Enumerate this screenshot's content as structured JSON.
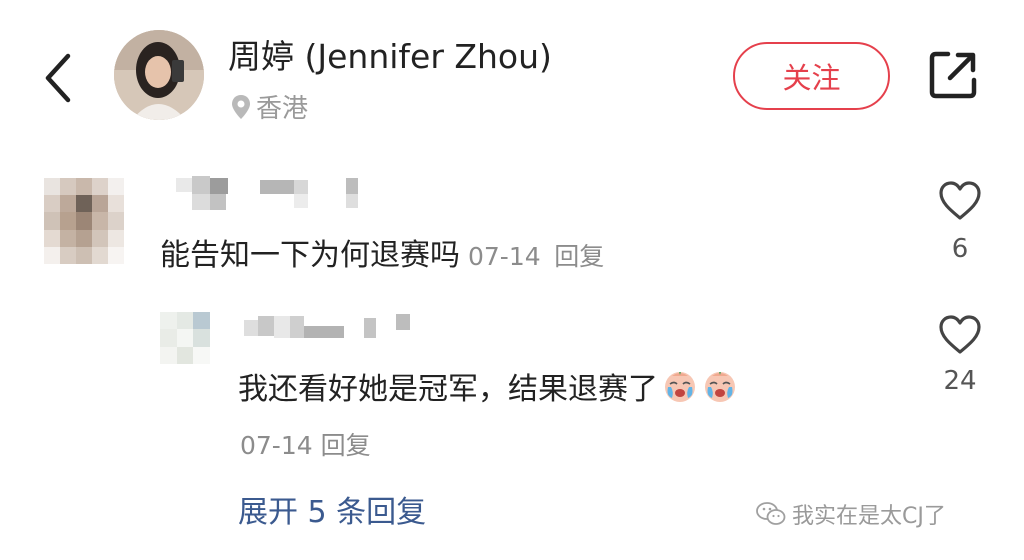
{
  "header": {
    "author_name": "周婷 (Jennifer Zhou)",
    "location": "香港",
    "follow_label": "关注"
  },
  "comments": [
    {
      "text": "能告知一下为何退赛吗",
      "date": "07-14",
      "reply_label": "回复",
      "likes": "6",
      "replies": [
        {
          "text": "我还看好她是冠军，结果退赛了",
          "date": "07-14",
          "reply_label": "回复",
          "likes": "24",
          "emojis": [
            "crying-face-icon",
            "crying-face-icon"
          ]
        }
      ],
      "expand_label": "展开 5 条回复"
    }
  ],
  "watermark": {
    "text": "我实在是太CJ了"
  },
  "colors": {
    "accent": "#e5404c",
    "link": "#3b5a8f",
    "muted": "#8c8c8c"
  }
}
